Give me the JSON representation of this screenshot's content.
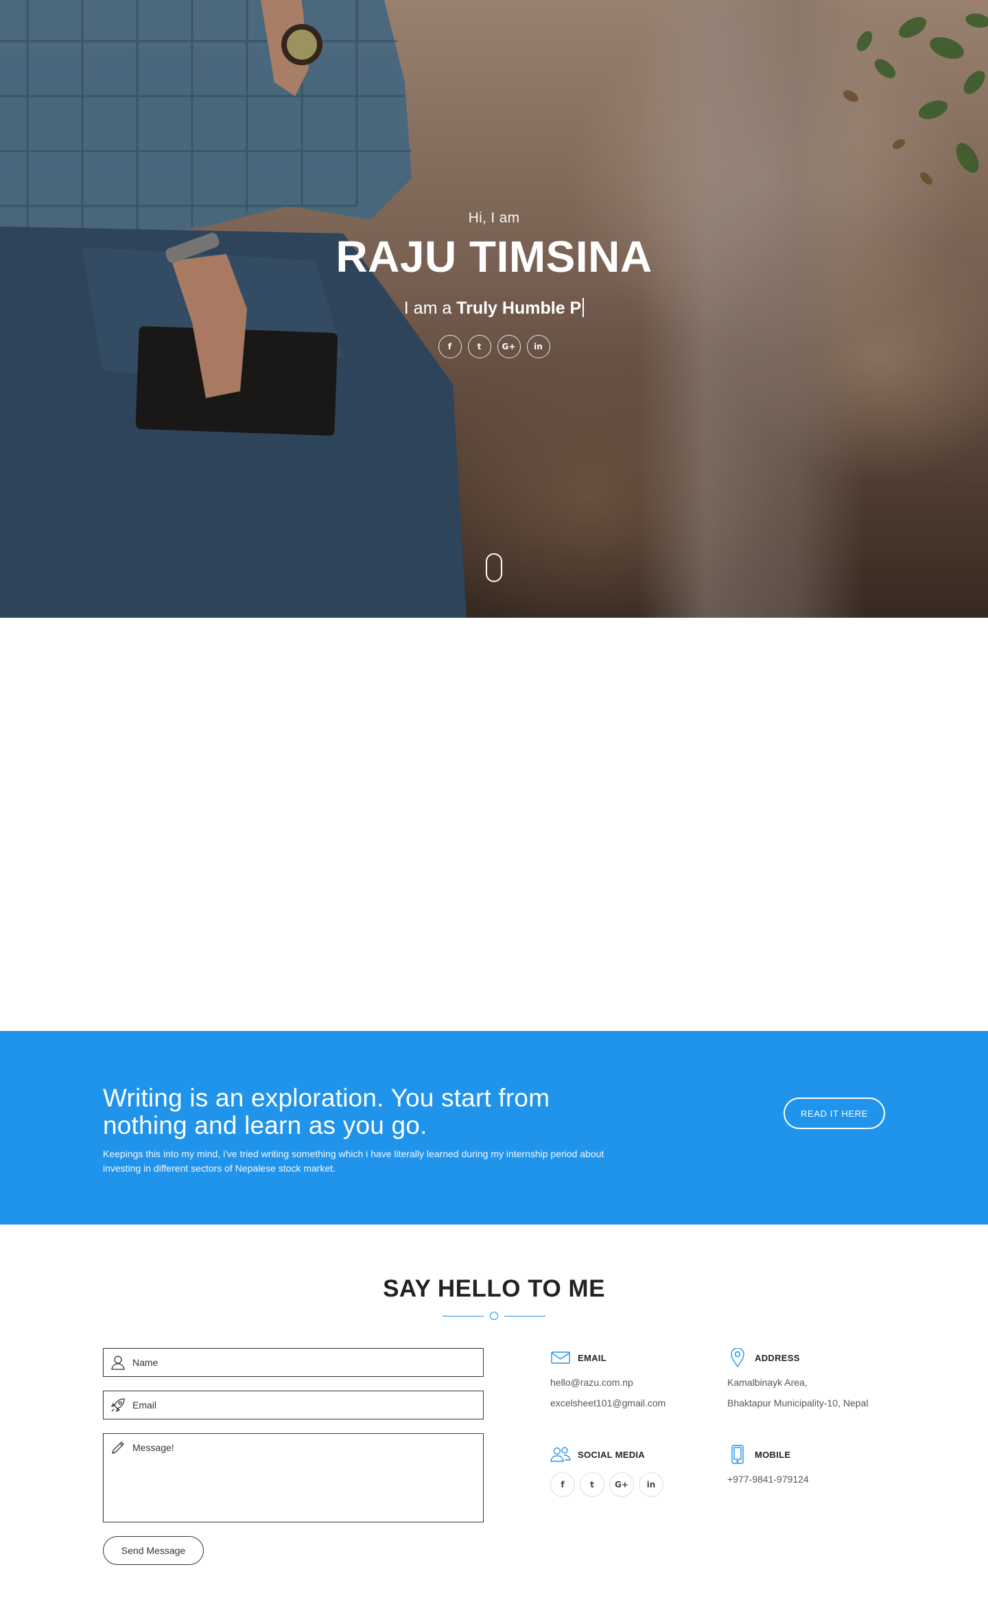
{
  "hero": {
    "greeting": "Hi, I am",
    "name": "RAJU TIMSINA",
    "tagline_prefix": "I am a",
    "tagline_typed": "Truly Humble P",
    "social": [
      {
        "icon": "facebook-icon",
        "glyph": "f"
      },
      {
        "icon": "twitter-icon",
        "glyph": "t"
      },
      {
        "icon": "google-plus-icon",
        "glyph": "G+"
      },
      {
        "icon": "linkedin-icon",
        "glyph": "in"
      }
    ]
  },
  "cta": {
    "title": "Writing is an exploration. You start from nothing and learn as you go.",
    "description": "Keepings this into my mind, i've tried writing something which i have literally learned during my internship period about investing in different sectors of Nepalese stock market.",
    "button_label": "READ IT HERE"
  },
  "contact": {
    "title": "SAY HELLO TO ME",
    "form": {
      "name_placeholder": "Name",
      "email_placeholder": "Email",
      "message_placeholder": "Message!",
      "send_label": "Send Message"
    },
    "email": {
      "label": "EMAIL",
      "lines": [
        "hello@razu.com.np",
        "excelsheet101@gmail.com"
      ]
    },
    "address": {
      "label": "ADDRESS",
      "lines": [
        "Kamalbinayk Area,",
        "Bhaktapur Municipality-10, Nepal"
      ]
    },
    "social_media": {
      "label": "SOCIAL MEDIA",
      "items": [
        {
          "icon": "facebook-icon",
          "glyph": "f"
        },
        {
          "icon": "twitter-icon",
          "glyph": "t"
        },
        {
          "icon": "google-plus-icon",
          "glyph": "G+"
        },
        {
          "icon": "linkedin-icon",
          "glyph": "in"
        }
      ]
    },
    "mobile": {
      "label": "MOBILE",
      "lines": [
        "+977-9841-979124"
      ]
    }
  },
  "colors": {
    "accent": "#2093eb",
    "heading": "#222222"
  }
}
